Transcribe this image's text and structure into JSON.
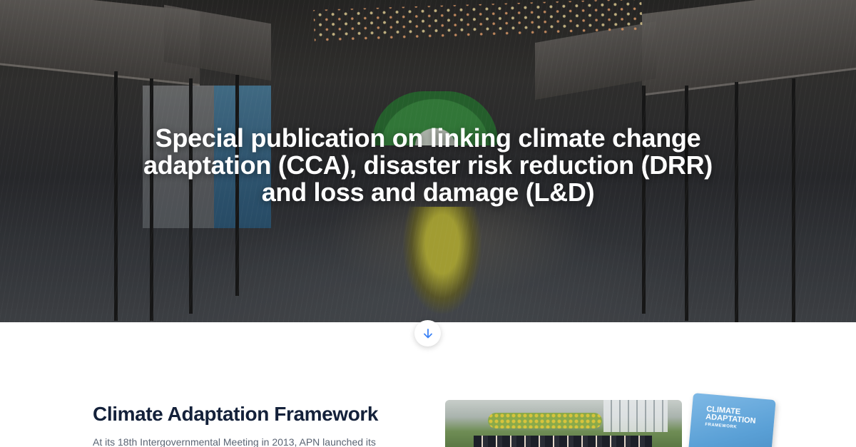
{
  "hero": {
    "title_line1": "Special publication on linking climate change",
    "title_line2": "adaptation (CCA), disaster risk reduction (DRR)",
    "title_line3": "and loss and damage (L&D)"
  },
  "scroll": {
    "icon": "arrow-down-icon",
    "color": "#3b82f6"
  },
  "section": {
    "title": "Climate Adaptation Framework",
    "text": "At its 18th Intergovernmental Meeting in 2013, APN launched its"
  },
  "book": {
    "title": "CLIMATE ADAPTATION",
    "subtitle": "FRAMEWORK"
  }
}
